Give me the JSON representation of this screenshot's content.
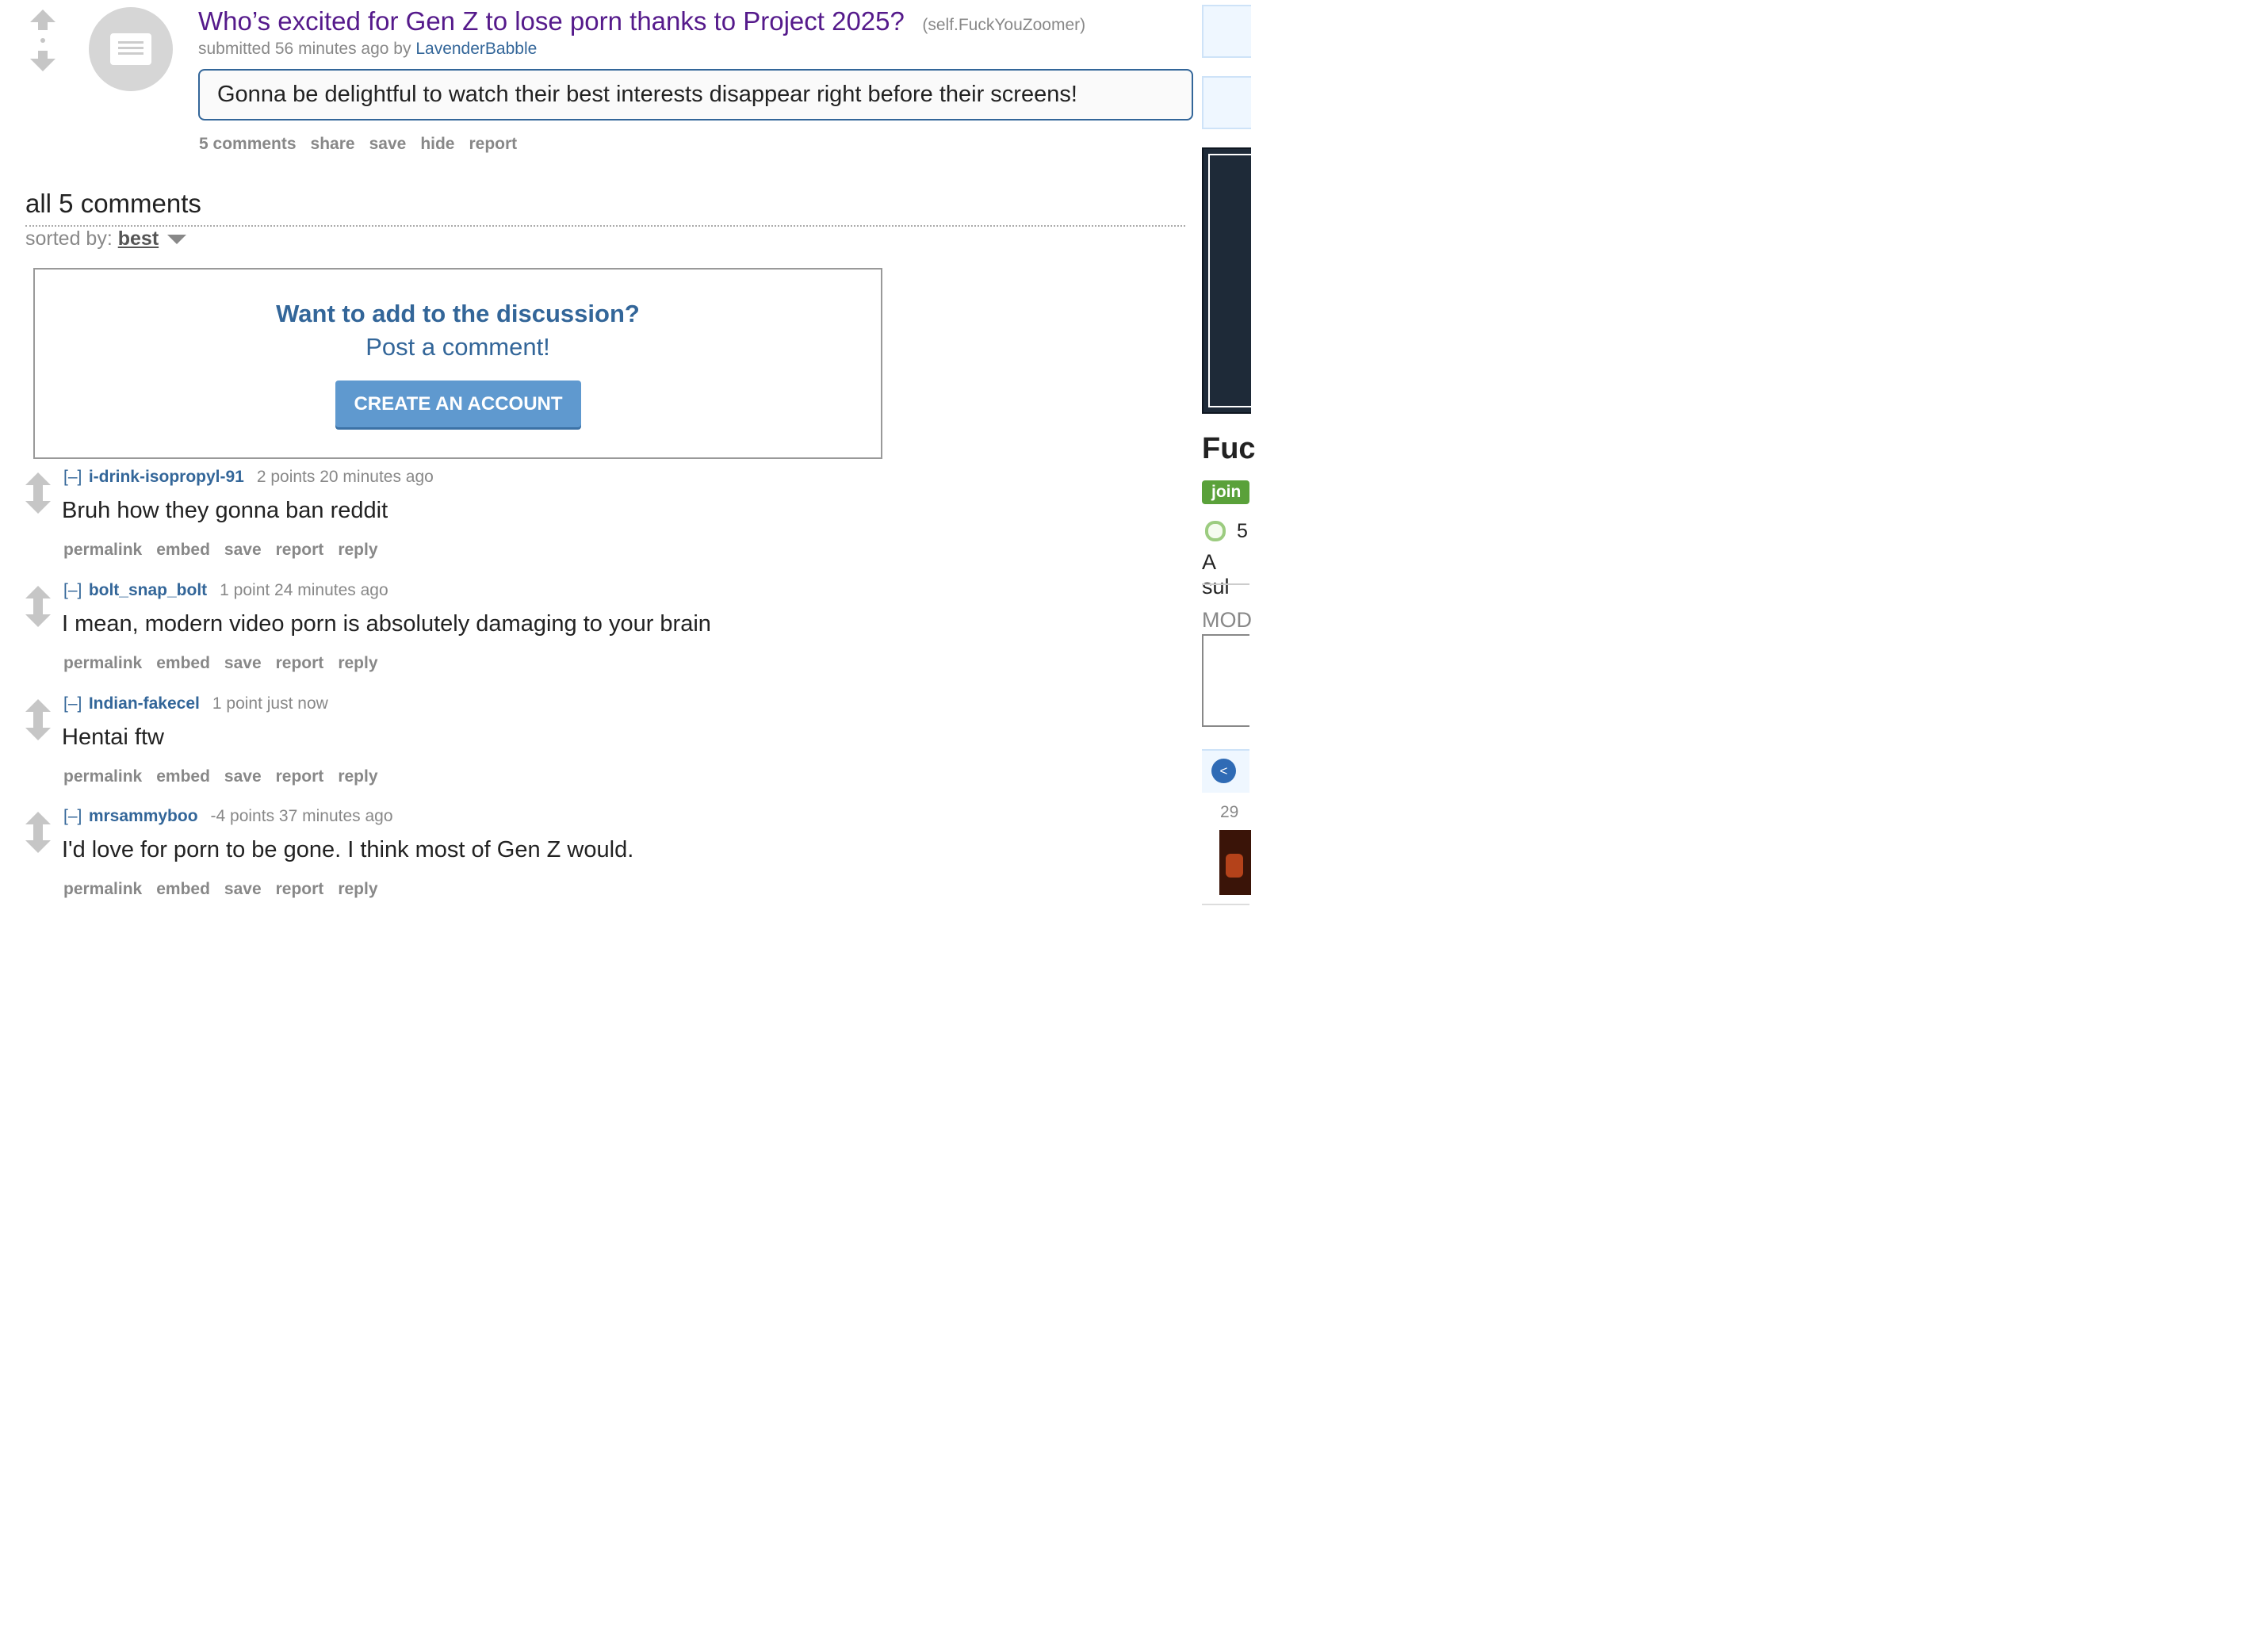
{
  "post": {
    "title": "Who’s excited for Gen Z to lose porn thanks to Project 2025?",
    "domain": "(self.FuckYouZoomer)",
    "submitted_prefix": "submitted 56 minutes ago by",
    "author": "LavenderBabble",
    "selftext": "Gonna be delightful to watch their best interests disappear right before their screens!",
    "buttons": [
      "5 comments",
      "share",
      "save",
      "hide",
      "report"
    ]
  },
  "comments_area": {
    "title": "all 5 comments",
    "sorted_label": "sorted by:",
    "sort_value": "best"
  },
  "prompt_panel": {
    "heading": "Want to add to the discussion?",
    "subheading": "Post a comment!",
    "cta": "CREATE AN ACCOUNT"
  },
  "comments": [
    {
      "collapse": "[–]",
      "author": "i-drink-isopropyl-91",
      "meta": "2 points 20 minutes ago",
      "body": "Bruh how they gonna ban reddit"
    },
    {
      "collapse": "[–]",
      "author": "bolt_snap_bolt",
      "meta": "1 point 24 minutes ago",
      "body": "I mean, modern video porn is absolutely damaging to your brain"
    },
    {
      "collapse": "[–]",
      "author": "Indian-fakecel",
      "meta": "1 point just now",
      "body": "Hentai ftw"
    },
    {
      "collapse": "[–]",
      "author": "mrsammyboo",
      "meta": "-4 points 37 minutes ago",
      "body": "I'd love for porn to be gone. I think most of Gen Z would."
    }
  ],
  "comment_buttons": [
    "permalink",
    "embed",
    "save",
    "report",
    "reply"
  ],
  "sidebar": {
    "sub_name_partial": "Fuc",
    "join_partial": "join",
    "online_partial": "5",
    "desc_partial": "A sul",
    "mods_partial": "MOD",
    "nav_prev": "<",
    "date_partial": "29"
  },
  "colors": {
    "title": "#551a8b",
    "link": "#336699",
    "cta": "#5f99cf",
    "join": "#5aa13a"
  }
}
